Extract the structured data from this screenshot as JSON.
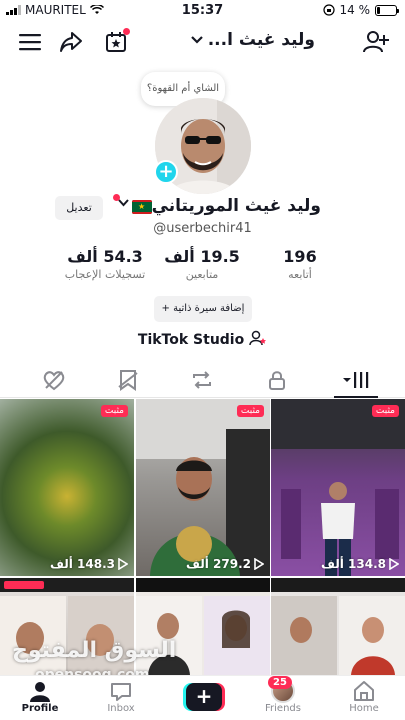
{
  "status_bar": {
    "carrier": "MAURITEL",
    "time": "15:37",
    "battery": "14 %"
  },
  "header": {
    "title": "وليد غيث ا...",
    "icons": [
      "menu-icon",
      "share-icon",
      "calendar-star-icon",
      "chevron-down-icon",
      "add-user-icon"
    ]
  },
  "profile": {
    "note_bubble": "الشاي أم القهوة؟",
    "name": "وليد غيث الموريتاني",
    "edit_label": "تعديل",
    "handle": "@userbechir41",
    "stats": [
      {
        "value": "196",
        "label": "أتابعه"
      },
      {
        "value": "19.5 ألف",
        "label": "متابعين"
      },
      {
        "value": "54.3 ألف",
        "label": "تسجيلات الإعجاب"
      }
    ],
    "bio_button": "إضافة سيرة ذاتية",
    "studio_label": "TikTok Studio"
  },
  "tabs": [
    "videos-grid",
    "private-lock",
    "reposts",
    "saved",
    "liked"
  ],
  "videos": [
    {
      "pinned": "مثبت",
      "views": "148.3 ألف",
      "bg": "#4f6b2a"
    },
    {
      "pinned": "مثبت",
      "views": "279.2 ألف",
      "bg": "#8d8a86"
    },
    {
      "pinned": "مثبت",
      "views": "134.8 ألف",
      "bg": "#7a3e8e"
    }
  ],
  "watermark": {
    "arabic": "السوق المفتوح",
    "latin": "opensooq.com"
  },
  "bottom_nav": {
    "profile": "Profile",
    "inbox": "Inbox",
    "friends": "Friends",
    "friends_badge": "25",
    "home": "Home"
  },
  "colors": {
    "accent_red": "#fe2c55",
    "accent_cyan": "#25f4ee",
    "text": "#161823"
  }
}
